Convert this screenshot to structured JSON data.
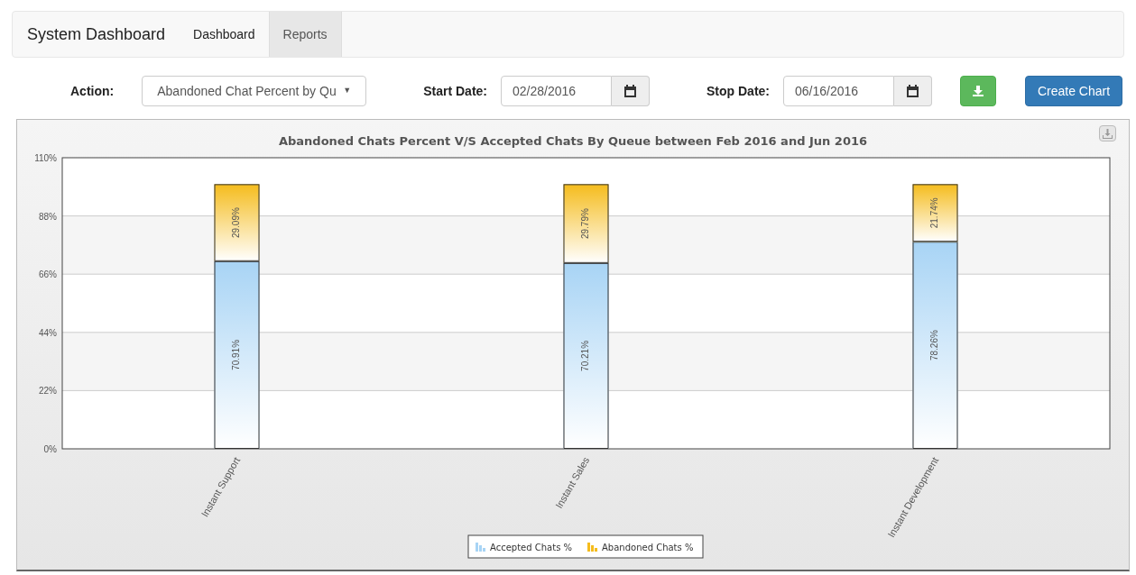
{
  "navbar": {
    "brand": "System Dashboard",
    "tabs": [
      {
        "label": "Dashboard",
        "selected": false
      },
      {
        "label": "Reports",
        "selected": true
      }
    ]
  },
  "form": {
    "action_label": "Action:",
    "action_value": "Abandoned Chat Percent by Qu",
    "action_caret": "▼",
    "start_label": "Start Date:",
    "start_value": "02/28/2016",
    "stop_label": "Stop Date:",
    "stop_value": "06/16/2016",
    "create_button": "Create Chart"
  },
  "chart": {
    "chart_data": {
      "type": "bar",
      "stacked": true,
      "grid": true,
      "legend": true,
      "title": "Abandoned Chats Percent V/S Accepted Chats By Queue between Feb 2016 and Jun 2016",
      "categories": [
        "Instant Support",
        "Instant Sales",
        "Instant Development"
      ],
      "series": [
        {
          "name": "Accepted Chats %",
          "color": "#a8d4f5",
          "values": [
            70.91,
            70.21,
            78.26
          ],
          "value_labels": [
            "70.91%",
            "70.21%",
            "78.26%"
          ]
        },
        {
          "name": "Abandoned Chats %",
          "color": "#f5bc1c",
          "values": [
            29.09,
            29.79,
            21.74
          ],
          "value_labels": [
            "29.09%",
            "29.79%",
            "21.74%"
          ]
        }
      ],
      "ylim": [
        0,
        110
      ],
      "yticks": [
        {
          "value": 0,
          "label": "0%"
        },
        {
          "value": 22,
          "label": "22%"
        },
        {
          "value": 44,
          "label": "44%"
        },
        {
          "value": 66,
          "label": "66%"
        },
        {
          "value": 88,
          "label": "88%"
        },
        {
          "value": 110,
          "label": "110%"
        }
      ],
      "data_labels": true
    }
  }
}
